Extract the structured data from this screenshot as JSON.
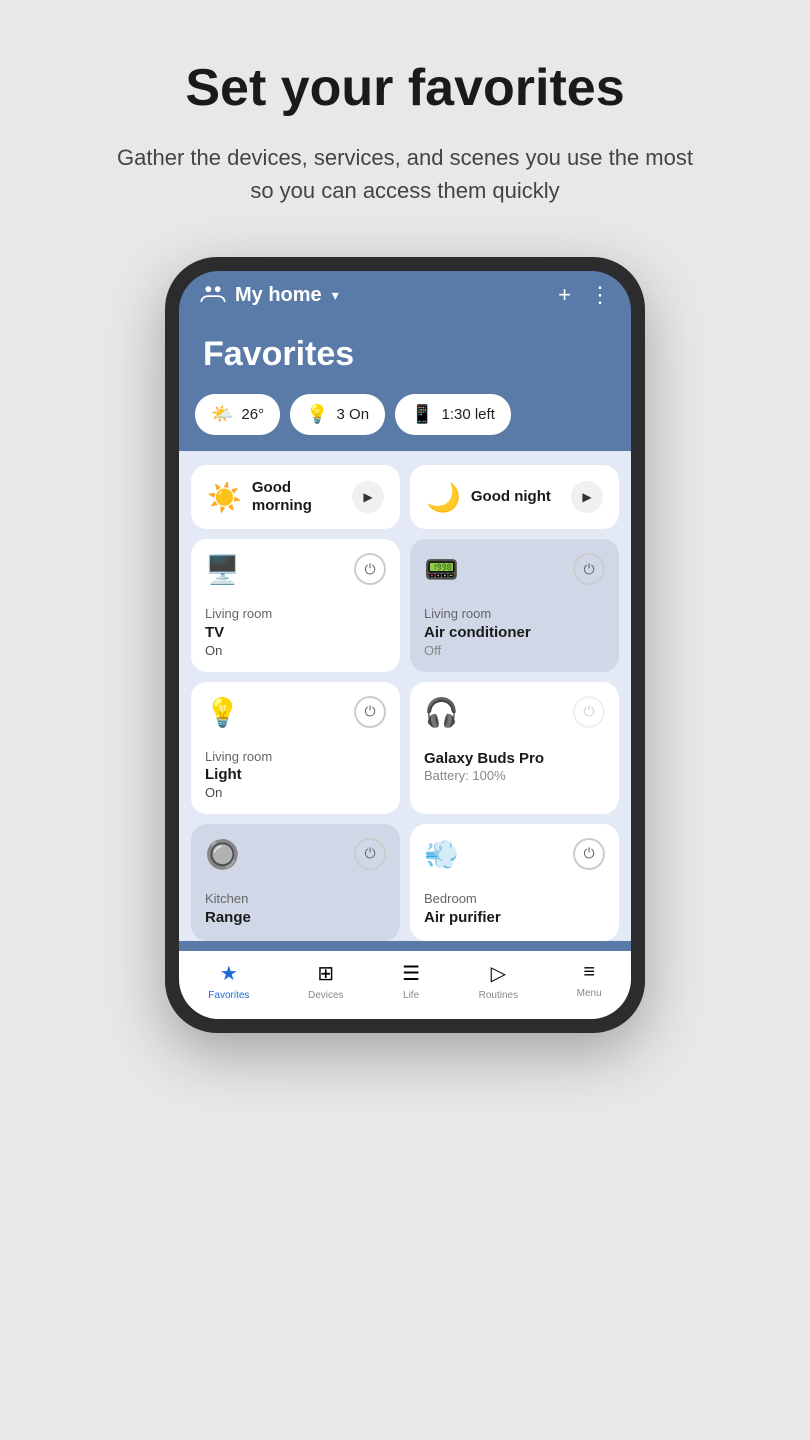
{
  "page": {
    "headline": "Set your favorites",
    "subtitle": "Gather the devices, services, and scenes you use the most so you can access them quickly"
  },
  "header": {
    "home_label": "My home",
    "dropdown_symbol": "▾",
    "add_label": "+",
    "more_label": "⋮"
  },
  "favorites_title": "Favorites",
  "chips": [
    {
      "icon": "🌤️",
      "label": "26°"
    },
    {
      "icon": "💡",
      "label": "3 On"
    },
    {
      "icon": "📱",
      "label": "1:30 left"
    }
  ],
  "scenes": [
    {
      "icon": "☀️",
      "name": "Good morning",
      "play": "▶"
    },
    {
      "icon": "🌙",
      "name": "Good night",
      "play": "▶"
    }
  ],
  "devices": [
    {
      "icon": "🖥️",
      "location": "Living room",
      "name": "TV",
      "status": "On",
      "on": true
    },
    {
      "icon": "📟",
      "location": "Living room",
      "name": "Air conditioner",
      "status": "Off",
      "on": false
    },
    {
      "icon": "💡",
      "location": "Living room",
      "name": "Light",
      "status": "On",
      "on": true
    },
    {
      "icon": "🎧",
      "location": "",
      "name": "Galaxy Buds Pro",
      "status": "Battery: 100%",
      "on": true
    },
    {
      "icon": "🔘",
      "location": "Kitchen",
      "name": "Range",
      "status": "",
      "on": false
    },
    {
      "icon": "💨",
      "location": "Bedroom",
      "name": "Air purifier",
      "status": "",
      "on": true
    }
  ],
  "nav": [
    {
      "icon": "★",
      "label": "Favorites",
      "active": true
    },
    {
      "icon": "⊞",
      "label": "Devices",
      "active": false
    },
    {
      "icon": "☰",
      "label": "Life",
      "active": false
    },
    {
      "icon": "▷",
      "label": "Routines",
      "active": false
    },
    {
      "icon": "≡",
      "label": "Menu",
      "active": false
    }
  ]
}
